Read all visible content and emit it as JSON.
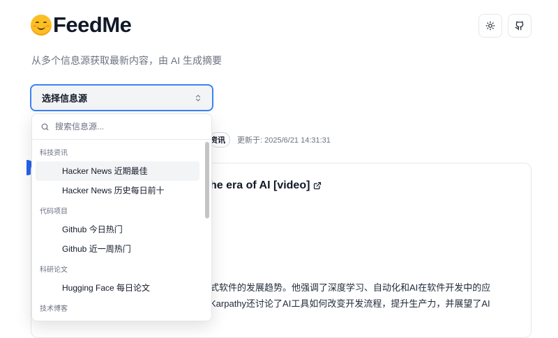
{
  "header": {
    "app_title": "FeedMe",
    "subtitle": "从多个信息源获取最新内容，由 AI 生成摘要"
  },
  "toolbar": {
    "theme_icon": "sun-icon",
    "github_icon": "github-icon"
  },
  "source_select": {
    "label": "选择信息源",
    "search_placeholder": "搜索信息源...",
    "groups": [
      {
        "label": "科技资讯",
        "items": [
          "Hacker News 近期最佳",
          "Hacker News 历史每日前十"
        ]
      },
      {
        "label": "代码项目",
        "items": [
          "Github 今日热门",
          "Github 近一周热门"
        ]
      },
      {
        "label": "科研论文",
        "items": [
          "Hugging Face 每日论文"
        ]
      },
      {
        "label": "技术博客",
        "items": []
      }
    ],
    "highlighted_item": "Hacker News 近期最佳"
  },
  "feed": {
    "tag": "资讯",
    "updated": "更新于: 2025/6/21 14:31:31",
    "card_title": "he era of AI [video]",
    "card_summary_line1": "式软件的发展趋势。他强调了深度学习、自动化和AI在软件开发中的应",
    "card_summary_line2": "Karpathy还讨论了AI工具如何改变开发流程，提升生产力，并展望了AI"
  },
  "colors": {
    "accent": "#3b82f6",
    "text": "#111827",
    "muted": "#6b7280",
    "border": "#e5e7eb"
  }
}
